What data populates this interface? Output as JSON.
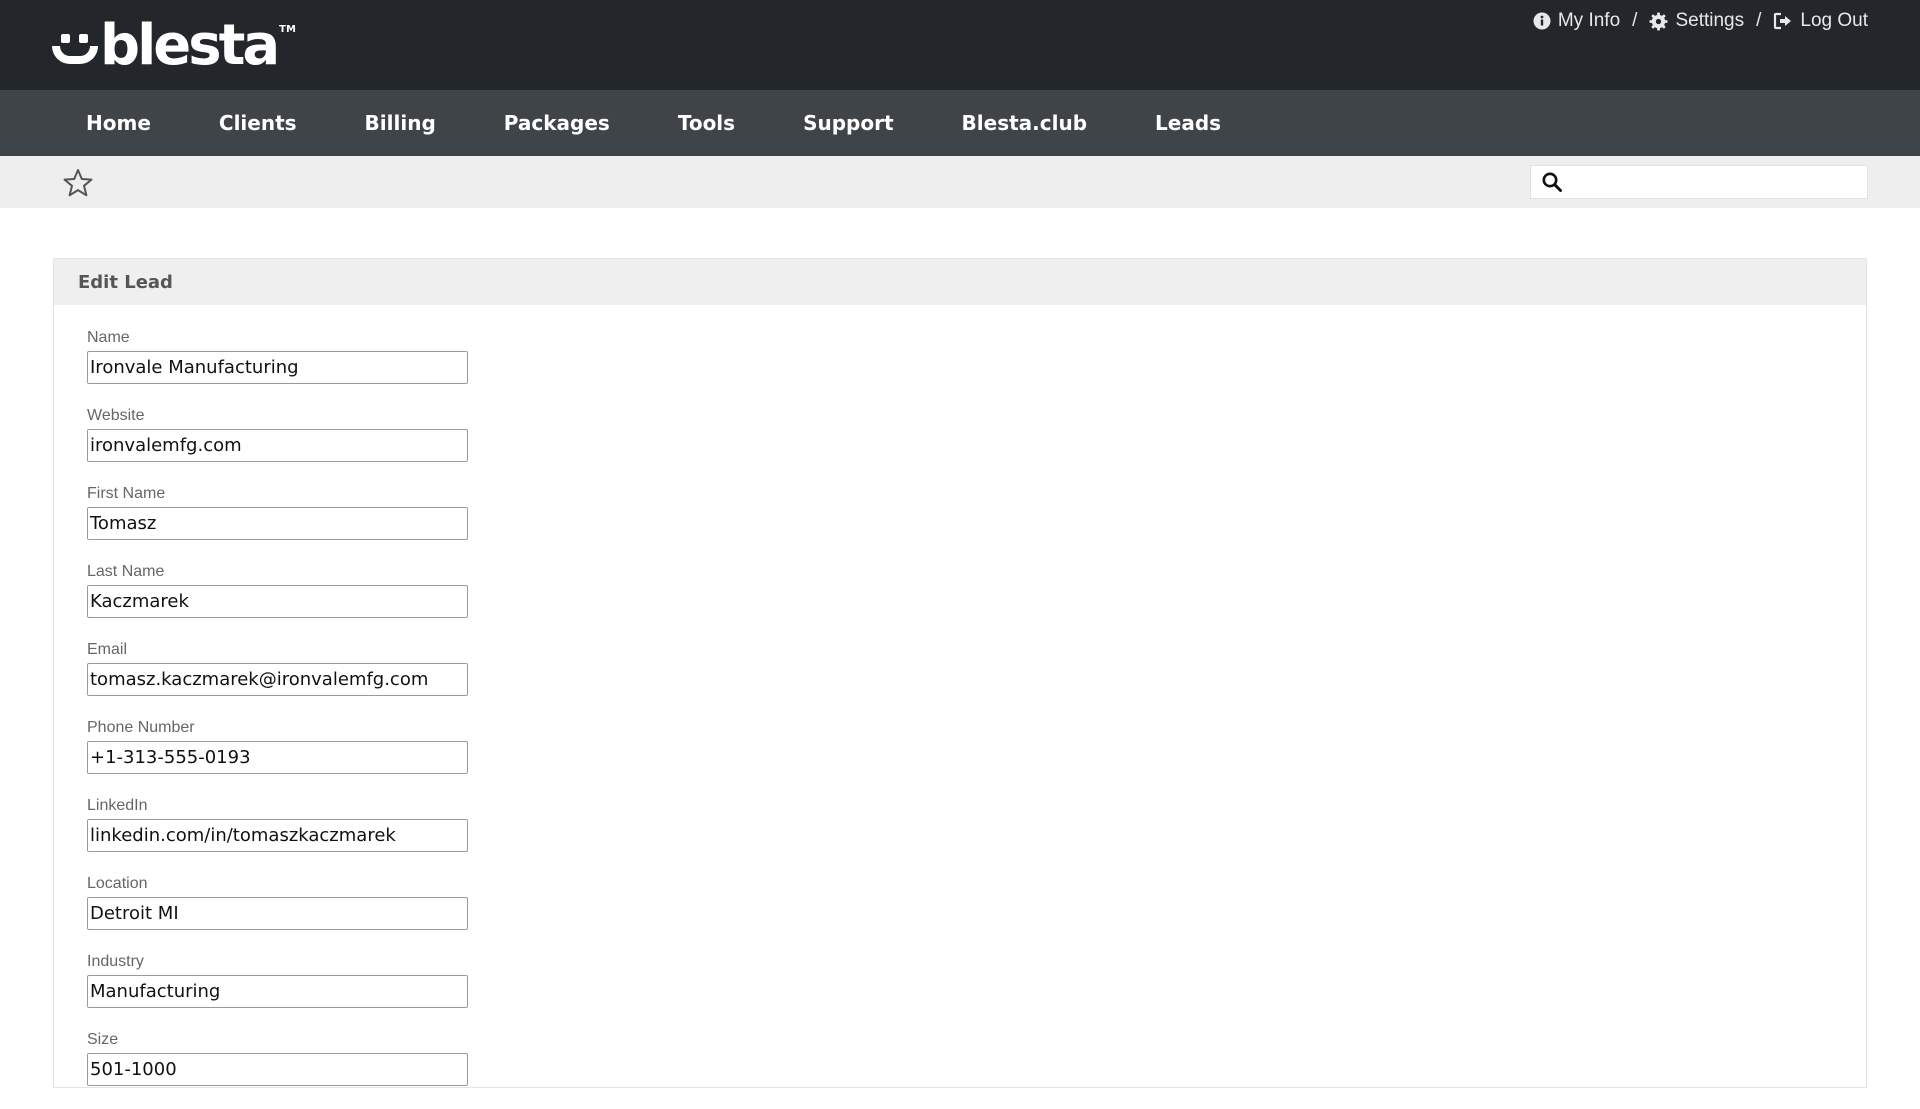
{
  "brand": {
    "name": "blesta",
    "trademark": "TM"
  },
  "top_links": [
    {
      "label": "My Info",
      "icon": "info-circle-icon"
    },
    {
      "label": "Settings",
      "icon": "gear-icon"
    },
    {
      "label": "Log Out",
      "icon": "sign-out-icon"
    }
  ],
  "separator": "/",
  "nav": {
    "items": [
      "Home",
      "Clients",
      "Billing",
      "Packages",
      "Tools",
      "Support",
      "Blesta.club",
      "Leads"
    ]
  },
  "subbar": {
    "favorite_icon": "star-outline-icon",
    "search_icon": "search-icon",
    "search_value": "",
    "search_placeholder": ""
  },
  "panel": {
    "title": "Edit Lead"
  },
  "form": {
    "fields": [
      {
        "label": "Name",
        "value": "Ironvale Manufacturing"
      },
      {
        "label": "Website",
        "value": "ironvalemfg.com"
      },
      {
        "label": "First Name",
        "value": "Tomasz"
      },
      {
        "label": "Last Name",
        "value": "Kaczmarek"
      },
      {
        "label": "Email",
        "value": "tomasz.kaczmarek@ironvalemfg.com"
      },
      {
        "label": "Phone Number",
        "value": "+1-313-555-0193"
      },
      {
        "label": "LinkedIn",
        "value": "linkedin.com/in/tomaszkaczmarek"
      },
      {
        "label": "Location",
        "value": "Detroit MI"
      },
      {
        "label": "Industry",
        "value": "Manufacturing"
      },
      {
        "label": "Size",
        "value": "501-1000"
      }
    ]
  },
  "colors": {
    "topbar": "#23272b",
    "navbar": "#3f4449",
    "subbar": "#eeeeee",
    "panel_header": "#efefef"
  }
}
